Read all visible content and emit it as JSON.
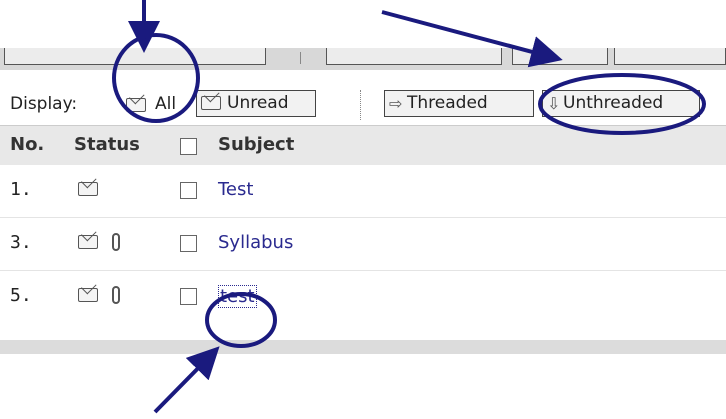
{
  "toolbar": {
    "display_label": "Display:",
    "all_label": "All",
    "unread_label": "Unread",
    "threaded_label": "Threaded",
    "unthreaded_label": "Unthreaded"
  },
  "table": {
    "headers": {
      "no": "No.",
      "status": "Status",
      "subject": "Subject"
    },
    "rows": [
      {
        "no": "1.",
        "subject": "Test",
        "attachment": false
      },
      {
        "no": "3.",
        "subject": "Syllabus",
        "attachment": true
      },
      {
        "no": "5.",
        "subject": "test",
        "attachment": true
      }
    ]
  },
  "annotation_color": "#1a1a7e",
  "icons": [
    "envelope-icon",
    "paperclip-icon",
    "threaded-icon",
    "unthreaded-icon"
  ]
}
